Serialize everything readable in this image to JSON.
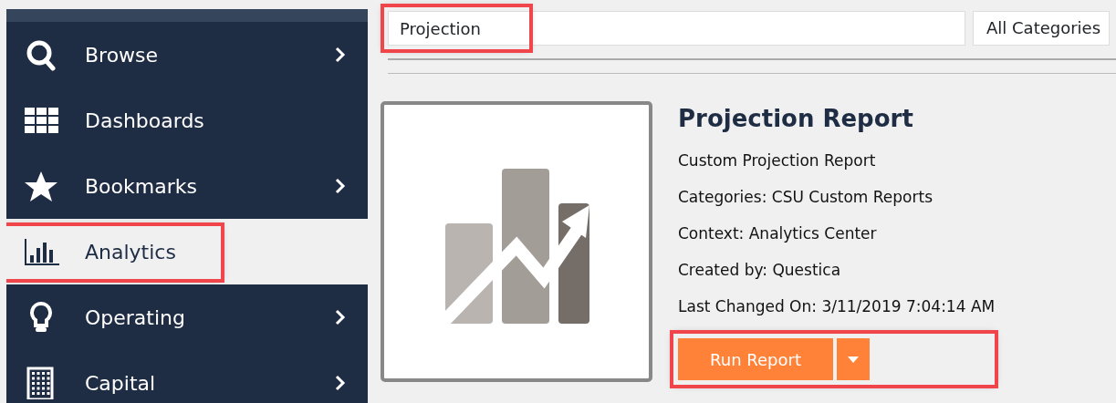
{
  "sidebar": {
    "items": [
      {
        "label": "Browse",
        "expandable": true,
        "selected": false,
        "highlighted": false
      },
      {
        "label": "Dashboards",
        "expandable": false,
        "selected": false,
        "highlighted": false
      },
      {
        "label": "Bookmarks",
        "expandable": true,
        "selected": false,
        "highlighted": false
      },
      {
        "label": "Analytics",
        "expandable": false,
        "selected": true,
        "highlighted": true
      },
      {
        "label": "Operating",
        "expandable": true,
        "selected": false,
        "highlighted": false
      },
      {
        "label": "Capital",
        "expandable": true,
        "selected": false,
        "highlighted": false
      }
    ]
  },
  "search": {
    "value": "Projection",
    "highlighted": true
  },
  "category_filter": {
    "value": "All Categories"
  },
  "report": {
    "title": "Projection Report",
    "details": [
      "Custom Projection Report",
      "Categories: CSU Custom Reports",
      "Context: Analytics Center",
      "Created by: Questica",
      "Last Changed On: 3/11/2019 7:04:14 AM"
    ],
    "run_button": {
      "label": "Run Report",
      "highlighted": true
    }
  }
}
